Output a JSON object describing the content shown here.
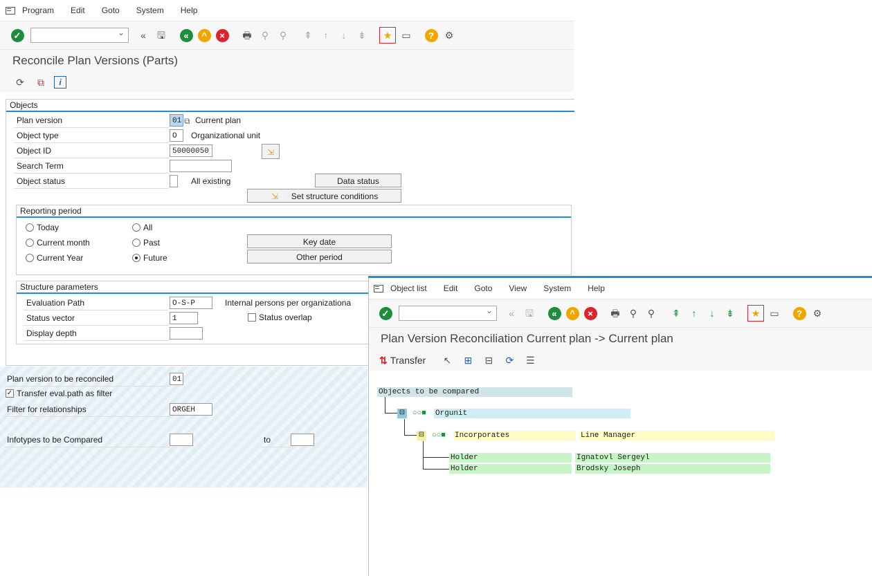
{
  "window1": {
    "menu": [
      "Program",
      "Edit",
      "Goto",
      "System",
      "Help"
    ],
    "title": "Reconcile Plan Versions (Parts)",
    "objects": {
      "heading": "Objects",
      "plan_version_label": "Plan version",
      "plan_version_value": "01",
      "plan_version_text": "Current plan",
      "object_type_label": "Object type",
      "object_type_value": "O",
      "object_type_text": "Organizational unit",
      "object_id_label": "Object ID",
      "object_id_value": "50000050",
      "search_term_label": "Search Term",
      "object_status_label": "Object status",
      "object_status_text": "All existing",
      "data_status_button": "Data status",
      "set_structure_button": "Set structure conditions"
    },
    "reporting_period": {
      "heading": "Reporting period",
      "options": [
        "Today",
        "All",
        "Current month",
        "Past",
        "Current Year",
        "Future"
      ],
      "selected": "Future",
      "key_date_button": "Key date",
      "other_period_button": "Other period"
    },
    "structure": {
      "heading": "Structure parameters",
      "eval_path_label": "Evaluation Path",
      "eval_path_value": "O-S-P",
      "eval_path_text": "Internal persons per organizationa",
      "status_vector_label": "Status vector",
      "status_vector_value": "1",
      "status_overlap_label": "Status overlap",
      "display_depth_label": "Display depth"
    },
    "lower": {
      "plan_reconciled_label": "Plan version to be reconciled",
      "plan_reconciled_value": "01",
      "transfer_eval_label": "Transfer eval.path as filter",
      "filter_label": "Filter for relationships",
      "filter_value": "ORGEH",
      "infotypes_label": "Infotypes to be Compared",
      "to_label": "to"
    }
  },
  "window2": {
    "menu": [
      "Object list",
      "Edit",
      "Goto",
      "View",
      "System",
      "Help"
    ],
    "title": "Plan Version Reconciliation Current plan -> Current plan",
    "transfer_label": "Transfer",
    "tree": {
      "root": "Objects to be compared",
      "level1": "Orgunit",
      "level2_a": "Incorporates",
      "level2_b": "Line Manager",
      "rows": [
        {
          "rel": "Holder",
          "name": "Ignatovl Sergeyl"
        },
        {
          "rel": "Holder",
          "name": "Brodsky Joseph"
        }
      ]
    }
  }
}
